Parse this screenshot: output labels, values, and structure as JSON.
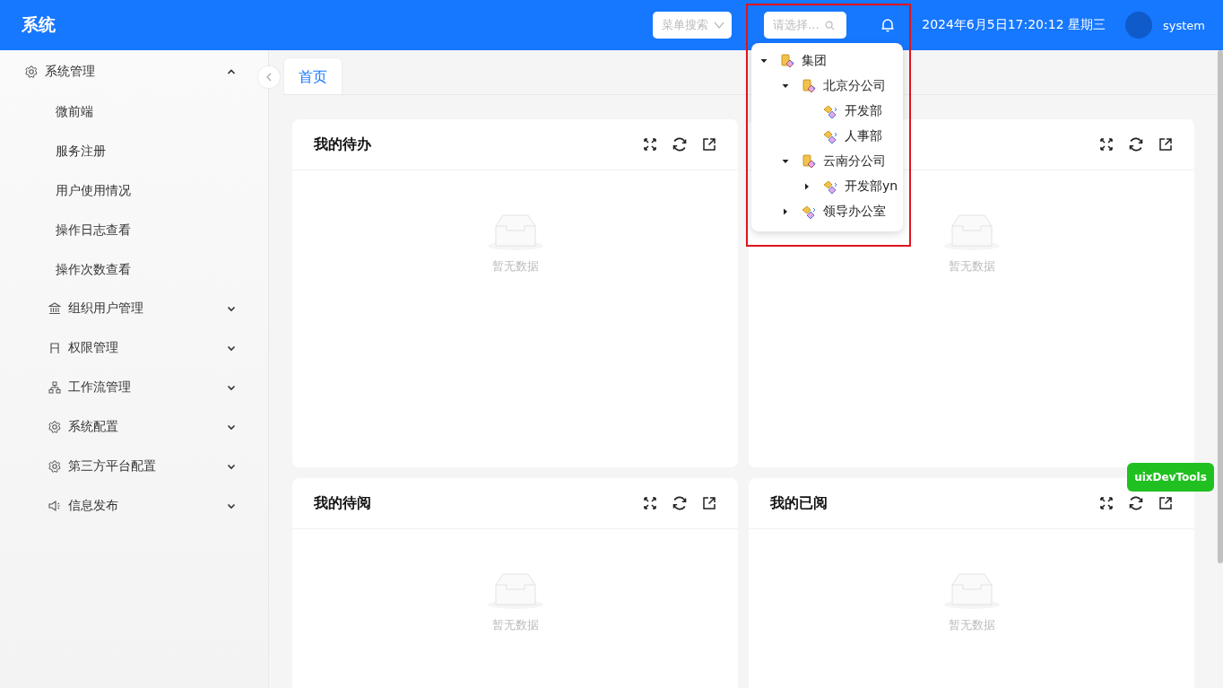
{
  "header": {
    "title": "系统",
    "menu_search": {
      "placeholder": "菜单搜索"
    },
    "org_select": {
      "placeholder": "请选择..."
    },
    "datetime": "2024年6月5日17:20:12 星期三",
    "user": "system"
  },
  "org_tree": [
    {
      "label": "集团",
      "kind": "company",
      "expanded": true,
      "children": [
        {
          "label": "北京分公司",
          "kind": "company",
          "expanded": true,
          "children": [
            {
              "label": "开发部",
              "kind": "dept"
            },
            {
              "label": "人事部",
              "kind": "dept"
            }
          ]
        },
        {
          "label": "云南分公司",
          "kind": "company",
          "expanded": true,
          "children": [
            {
              "label": "开发部yn",
              "kind": "dept",
              "expanded": false
            }
          ]
        },
        {
          "label": "领导办公室",
          "kind": "dept",
          "expanded": false
        }
      ]
    }
  ],
  "sidebar": {
    "items": [
      {
        "label": "系统管理",
        "kind": "gear",
        "expanded": true,
        "children": [
          {
            "label": "微前端"
          },
          {
            "label": "服务注册"
          },
          {
            "label": "用户使用情况"
          },
          {
            "label": "操作日志查看"
          },
          {
            "label": "操作次数查看"
          }
        ]
      },
      {
        "label": "组织用户管理",
        "kind": "bank",
        "expanded": false
      },
      {
        "label": "权限管理",
        "kind": "door",
        "expanded": false
      },
      {
        "label": "工作流管理",
        "kind": "hierarchy",
        "expanded": false
      },
      {
        "label": "系统配置",
        "kind": "gear",
        "expanded": false
      },
      {
        "label": "第三方平台配置",
        "kind": "gear",
        "expanded": false
      },
      {
        "label": "信息发布",
        "kind": "speaker",
        "expanded": false
      }
    ]
  },
  "tabs": [
    {
      "label": "首页",
      "selected": true
    }
  ],
  "cards": [
    {
      "title": "我的待办",
      "empty_text": "暂无数据"
    },
    {
      "empty_text": "暂无数据"
    },
    {
      "title": "我的待阅",
      "empty_text": "暂无数据"
    },
    {
      "title": "我的已阅",
      "empty_text": "暂无数据"
    }
  ],
  "devtools_button": "uixDevTools"
}
